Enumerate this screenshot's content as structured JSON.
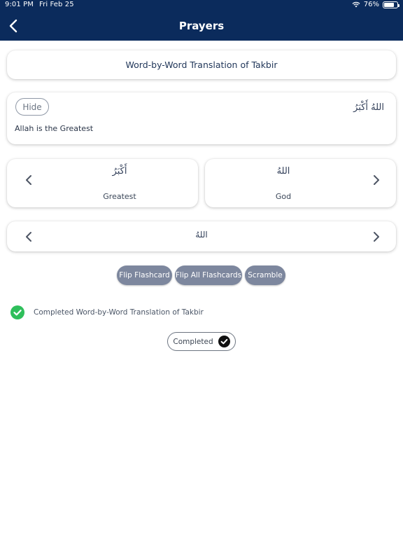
{
  "status": {
    "time": "9:01 PM",
    "date": "Fri Feb 25",
    "battery": "76%",
    "battery_level": 0.76
  },
  "header": {
    "title": "Prayers",
    "back_icon": "chevron-left-icon"
  },
  "lesson": {
    "title": "Word-by-Word Translation of Takbir"
  },
  "translation": {
    "hide_label": "Hide",
    "arabic": "اللهُ أَكْبَرُ",
    "english": "Allah is the Greatest"
  },
  "flashcards": [
    {
      "arabic": "أَكْبَرُ",
      "english": "Greatest"
    },
    {
      "arabic": "اللهُ",
      "english": "God"
    }
  ],
  "selector": {
    "arabic": "اللهُ"
  },
  "actions": {
    "flip": "Flip Flashcard",
    "flip_all": "Flip All Flashcards",
    "scramble": "Scramble"
  },
  "completion": {
    "message": "Completed Word-by-Word Translation of Takbir",
    "button_label": "Completed"
  },
  "colors": {
    "header_bg": "#0b2b5c",
    "pill_bg": "#7d879e",
    "success": "#2fbf5b"
  }
}
